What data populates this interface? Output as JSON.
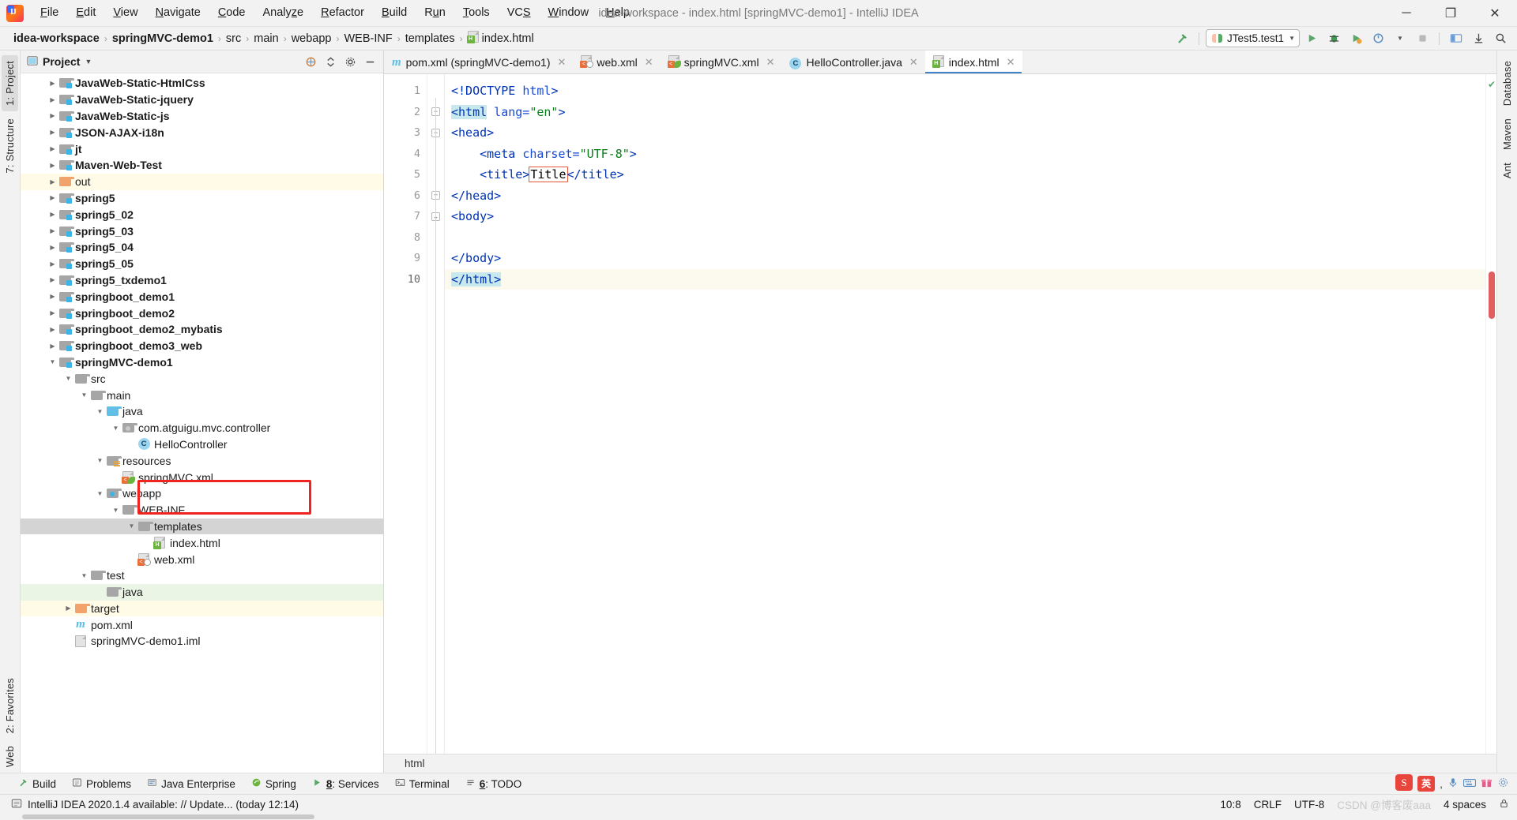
{
  "window": {
    "title": "idea-workspace - index.html [springMVC-demo1] - IntelliJ IDEA",
    "minimize": "─",
    "maximize": "❐",
    "close": "✕"
  },
  "menubar": {
    "items": [
      {
        "label": "File"
      },
      {
        "label": "Edit"
      },
      {
        "label": "View"
      },
      {
        "label": "Navigate"
      },
      {
        "label": "Code"
      },
      {
        "label": "Analyze"
      },
      {
        "label": "Refactor"
      },
      {
        "label": "Build"
      },
      {
        "label": "Run"
      },
      {
        "label": "Tools"
      },
      {
        "label": "VCS"
      },
      {
        "label": "Window"
      },
      {
        "label": "Help"
      }
    ]
  },
  "navbar": {
    "crumbs": [
      "idea-workspace",
      "springMVC-demo1",
      "src",
      "main",
      "webapp",
      "WEB-INF",
      "templates",
      "index.html"
    ],
    "separator": "›",
    "run_config": "JTest5.test1",
    "run_caret": "▼",
    "buttons": [
      {
        "name": "build-hammer-icon",
        "glyph": "⚒"
      },
      {
        "name": "run-icon",
        "glyph": "▶"
      },
      {
        "name": "debug-icon",
        "glyph": "ὁE"
      },
      {
        "name": "run-coverage-icon",
        "glyph": "▶"
      },
      {
        "name": "profile-icon",
        "glyph": "◴"
      },
      {
        "name": "stop-icon",
        "glyph": "■"
      },
      {
        "name": "layout-icon",
        "glyph": "▦"
      },
      {
        "name": "update-icon",
        "glyph": "⬇"
      },
      {
        "name": "search-everywhere-icon",
        "glyph": "ὐD"
      }
    ]
  },
  "left_strip": {
    "tabs": [
      {
        "label": "1: Project",
        "active": true,
        "name": "tool-tab-project"
      },
      {
        "label": "7: Structure",
        "active": false,
        "name": "tool-tab-structure"
      },
      {
        "label": "2: Favorites",
        "active": false,
        "name": "tool-tab-favorites"
      },
      {
        "label": "Web",
        "active": false,
        "name": "tool-tab-web"
      }
    ]
  },
  "right_strip": {
    "tabs": [
      {
        "label": "Database",
        "name": "tool-tab-database"
      },
      {
        "label": "Maven",
        "name": "tool-tab-maven"
      },
      {
        "label": "Ant",
        "name": "tool-tab-ant"
      }
    ]
  },
  "project_panel": {
    "title": "Project",
    "caret": "▼",
    "actions": [
      {
        "name": "select-opened-file-icon",
        "glyph": "⊕"
      },
      {
        "name": "collapse-all-icon",
        "glyph": "⇱"
      },
      {
        "name": "settings-gear-icon",
        "glyph": "⚙"
      },
      {
        "name": "hide-panel-icon",
        "glyph": "─"
      }
    ],
    "tree": [
      {
        "label": "JavaWeb-Static-HtmlCss",
        "indent": 1,
        "arrow": "right",
        "icon": "module-folder",
        "bold": true
      },
      {
        "label": "JavaWeb-Static-jquery",
        "indent": 1,
        "arrow": "right",
        "icon": "module-folder",
        "bold": true
      },
      {
        "label": "JavaWeb-Static-js",
        "indent": 1,
        "arrow": "right",
        "icon": "module-folder",
        "bold": true
      },
      {
        "label": "JSON-AJAX-i18n",
        "indent": 1,
        "arrow": "right",
        "icon": "module-folder",
        "bold": true
      },
      {
        "label": "jt",
        "indent": 1,
        "arrow": "right",
        "icon": "module-folder",
        "bold": true
      },
      {
        "label": "Maven-Web-Test",
        "indent": 1,
        "arrow": "right",
        "icon": "module-folder",
        "bold": true
      },
      {
        "label": "out",
        "indent": 1,
        "arrow": "right",
        "icon": "excluded-folder",
        "bold": false,
        "highlight": "yellow"
      },
      {
        "label": "spring5",
        "indent": 1,
        "arrow": "right",
        "icon": "module-folder",
        "bold": true
      },
      {
        "label": "spring5_02",
        "indent": 1,
        "arrow": "right",
        "icon": "module-folder",
        "bold": true
      },
      {
        "label": "spring5_03",
        "indent": 1,
        "arrow": "right",
        "icon": "module-folder",
        "bold": true
      },
      {
        "label": "spring5_04",
        "indent": 1,
        "arrow": "right",
        "icon": "module-folder",
        "bold": true
      },
      {
        "label": "spring5_05",
        "indent": 1,
        "arrow": "right",
        "icon": "module-folder",
        "bold": true
      },
      {
        "label": "spring5_txdemo1",
        "indent": 1,
        "arrow": "right",
        "icon": "module-folder",
        "bold": true
      },
      {
        "label": "springboot_demo1",
        "indent": 1,
        "arrow": "right",
        "icon": "module-folder",
        "bold": true
      },
      {
        "label": "springboot_demo2",
        "indent": 1,
        "arrow": "right",
        "icon": "module-folder",
        "bold": true
      },
      {
        "label": "springboot_demo2_mybatis",
        "indent": 1,
        "arrow": "right",
        "icon": "module-folder",
        "bold": true
      },
      {
        "label": "springboot_demo3_web",
        "indent": 1,
        "arrow": "right",
        "icon": "module-folder",
        "bold": true
      },
      {
        "label": "springMVC-demo1",
        "indent": 1,
        "arrow": "down",
        "icon": "module-folder",
        "bold": true
      },
      {
        "label": "src",
        "indent": 2,
        "arrow": "down",
        "icon": "folder"
      },
      {
        "label": "main",
        "indent": 3,
        "arrow": "down",
        "icon": "folder"
      },
      {
        "label": "java",
        "indent": 4,
        "arrow": "down",
        "icon": "source-folder"
      },
      {
        "label": "com.atguigu.mvc.controller",
        "indent": 5,
        "arrow": "down",
        "icon": "package-folder"
      },
      {
        "label": "HelloController",
        "indent": 6,
        "arrow": "none",
        "icon": "java-class"
      },
      {
        "label": "resources",
        "indent": 4,
        "arrow": "down",
        "icon": "resources-folder"
      },
      {
        "label": "springMVC.xml",
        "indent": 5,
        "arrow": "none",
        "icon": "spring-xml-file"
      },
      {
        "label": "webapp",
        "indent": 4,
        "arrow": "down",
        "icon": "webapp-folder"
      },
      {
        "label": "WEB-INF",
        "indent": 5,
        "arrow": "down",
        "icon": "folder"
      },
      {
        "label": "templates",
        "indent": 6,
        "arrow": "down",
        "icon": "folder",
        "highlight": "grey"
      },
      {
        "label": "index.html",
        "indent": 7,
        "arrow": "none",
        "icon": "html-file"
      },
      {
        "label": "web.xml",
        "indent": 6,
        "arrow": "none",
        "icon": "web-xml-file"
      },
      {
        "label": "test",
        "indent": 3,
        "arrow": "down",
        "icon": "folder"
      },
      {
        "label": "java",
        "indent": 4,
        "arrow": "none",
        "icon": "folder",
        "highlight": "green"
      },
      {
        "label": "target",
        "indent": 2,
        "arrow": "right",
        "icon": "excluded-folder",
        "highlight": "yellow"
      },
      {
        "label": "pom.xml",
        "indent": 2,
        "arrow": "none",
        "icon": "maven-file"
      },
      {
        "label": "springMVC-demo1.iml",
        "indent": 2,
        "arrow": "none",
        "icon": "iml-file"
      }
    ]
  },
  "editor": {
    "tabs": [
      {
        "label": "pom.xml (springMVC-demo1)",
        "icon": "maven-file",
        "active": false,
        "close": "✕"
      },
      {
        "label": "web.xml",
        "icon": "web-xml-file",
        "active": false,
        "close": "✕"
      },
      {
        "label": "springMVC.xml",
        "icon": "spring-xml-file",
        "active": false,
        "close": "✕"
      },
      {
        "label": "HelloController.java",
        "icon": "java-class",
        "active": false,
        "close": "✕"
      },
      {
        "label": "index.html",
        "icon": "html-file",
        "active": true,
        "close": "✕"
      }
    ],
    "line_numbers": [
      "1",
      "2",
      "3",
      "4",
      "5",
      "6",
      "7",
      "8",
      "9",
      "10"
    ],
    "current_line": 10,
    "lines": [
      {
        "n": 1,
        "segments": [
          {
            "t": "<!DOCTYPE ",
            "c": "tag"
          },
          {
            "t": "html",
            "c": "attr"
          },
          {
            "t": ">",
            "c": "tag"
          }
        ]
      },
      {
        "n": 2,
        "segments": [
          {
            "t": "<html",
            "c": "tag",
            "sel": true
          },
          {
            "t": " lang=",
            "c": "attr"
          },
          {
            "t": "\"en\"",
            "c": "str"
          },
          {
            "t": ">",
            "c": "tag"
          }
        ]
      },
      {
        "n": 3,
        "segments": [
          {
            "t": "<head>",
            "c": "tag"
          }
        ]
      },
      {
        "n": 4,
        "segments": [
          {
            "t": "    <meta ",
            "c": "tag"
          },
          {
            "t": "charset=",
            "c": "attr"
          },
          {
            "t": "\"UTF-8\"",
            "c": "str"
          },
          {
            "t": ">",
            "c": "tag"
          }
        ]
      },
      {
        "n": 5,
        "segments": [
          {
            "t": "    <title>",
            "c": "tag"
          },
          {
            "t": "Title",
            "c": "txt",
            "err": true
          },
          {
            "t": "</title>",
            "c": "tag"
          }
        ]
      },
      {
        "n": 6,
        "segments": [
          {
            "t": "</head>",
            "c": "tag"
          }
        ]
      },
      {
        "n": 7,
        "segments": [
          {
            "t": "<body>",
            "c": "tag"
          }
        ]
      },
      {
        "n": 8,
        "segments": [
          {
            "t": "",
            "c": "tag"
          }
        ]
      },
      {
        "n": 9,
        "segments": [
          {
            "t": "</body>",
            "c": "tag"
          }
        ]
      },
      {
        "n": 10,
        "segments": [
          {
            "t": "</html>",
            "c": "tag",
            "sel": true
          }
        ]
      }
    ],
    "bottom_breadcrumb": "html"
  },
  "tool_window_bar": {
    "items": [
      {
        "label": "Build",
        "icon": "hammer-icon",
        "name": "toolwin-build"
      },
      {
        "label": "Problems",
        "icon": "problems-icon",
        "name": "toolwin-problems"
      },
      {
        "label": "Java Enterprise",
        "icon": "java-enterprise-icon",
        "name": "toolwin-java-enterprise"
      },
      {
        "label": "Spring",
        "icon": "spring-icon",
        "name": "toolwin-spring"
      },
      {
        "label": "8: Services",
        "icon": "services-icon",
        "name": "toolwin-services"
      },
      {
        "label": "Terminal",
        "icon": "terminal-icon",
        "name": "toolwin-terminal"
      },
      {
        "label": "6: TODO",
        "icon": "todo-icon",
        "name": "toolwin-todo"
      }
    ],
    "ime": {
      "logo": "S",
      "lang": "英",
      "icons": [
        "Ἲ4",
        "⌨",
        "Ἰ1",
        "⚙"
      ]
    }
  },
  "statusbar": {
    "message": "IntelliJ IDEA 2020.1.4 available: // Update... (today 12:14)",
    "caret_position": "10:8",
    "line_separator": "CRLF",
    "encoding": "UTF-8",
    "indent": "4 spaces",
    "watermark": "CSDN @博客废aaa",
    "lock_icon": "ὑ2"
  }
}
